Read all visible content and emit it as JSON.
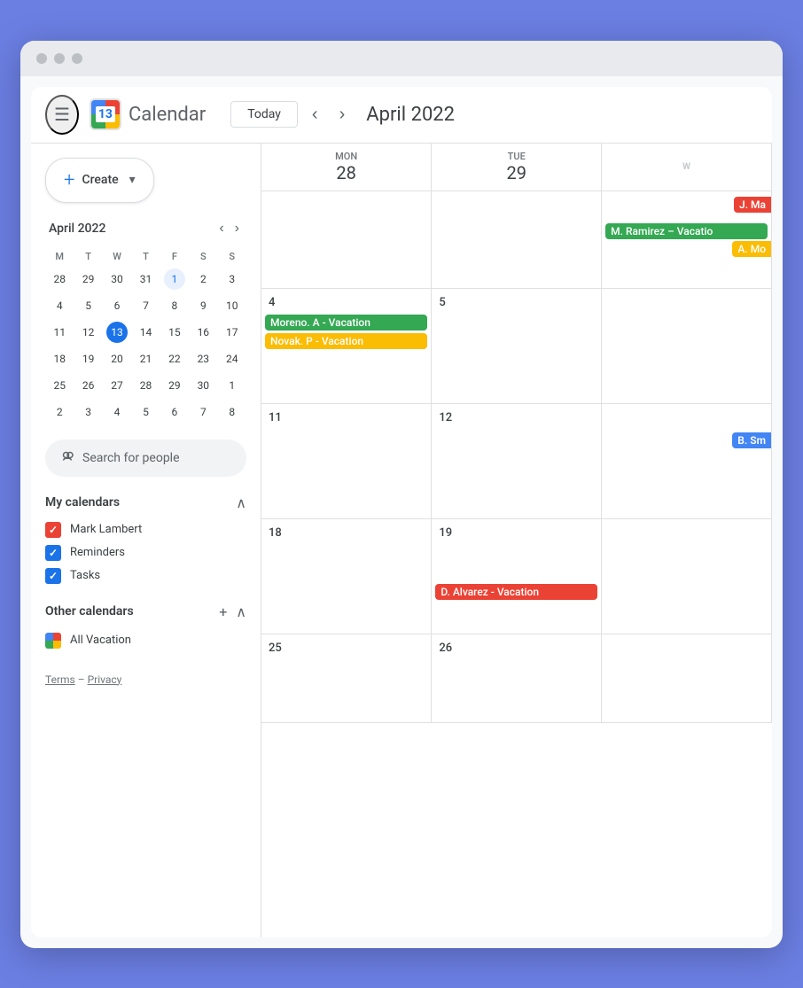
{
  "browser": {
    "dots": [
      "dot1",
      "dot2",
      "dot3"
    ]
  },
  "header": {
    "menu_icon": "☰",
    "app_name": "Calendar",
    "today_btn": "Today",
    "prev_icon": "‹",
    "next_icon": "›",
    "current_month": "April 2022"
  },
  "create_button": {
    "plus": "+",
    "label": "Create",
    "chevron": "▾"
  },
  "mini_calendar": {
    "title": "April 2022",
    "prev": "‹",
    "next": "›",
    "weekdays": [
      "M",
      "T",
      "W",
      "T",
      "F",
      "S",
      "S"
    ],
    "weeks": [
      [
        {
          "d": "28",
          "other": true
        },
        {
          "d": "29",
          "other": true
        },
        {
          "d": "30",
          "other": true
        },
        {
          "d": "31",
          "other": true
        },
        {
          "d": "1",
          "first": true
        },
        {
          "d": "2"
        },
        {
          "d": "3"
        }
      ],
      [
        {
          "d": "4"
        },
        {
          "d": "5"
        },
        {
          "d": "6"
        },
        {
          "d": "7"
        },
        {
          "d": "8"
        },
        {
          "d": "9"
        },
        {
          "d": "10"
        }
      ],
      [
        {
          "d": "11"
        },
        {
          "d": "12"
        },
        {
          "d": "13",
          "today": true
        },
        {
          "d": "14"
        },
        {
          "d": "15"
        },
        {
          "d": "16"
        },
        {
          "d": "17"
        }
      ],
      [
        {
          "d": "18"
        },
        {
          "d": "19"
        },
        {
          "d": "20"
        },
        {
          "d": "21"
        },
        {
          "d": "22"
        },
        {
          "d": "23"
        },
        {
          "d": "24"
        }
      ],
      [
        {
          "d": "25"
        },
        {
          "d": "26"
        },
        {
          "d": "27"
        },
        {
          "d": "28"
        },
        {
          "d": "29"
        },
        {
          "d": "30"
        },
        {
          "d": "1",
          "other": true
        }
      ],
      [
        {
          "d": "2",
          "other": true
        },
        {
          "d": "3",
          "other": true
        },
        {
          "d": "4",
          "other": true
        },
        {
          "d": "5",
          "other": true
        },
        {
          "d": "6",
          "other": true
        },
        {
          "d": "7",
          "other": true
        },
        {
          "d": "8",
          "other": true
        }
      ]
    ]
  },
  "search_people": {
    "placeholder": "Search for people"
  },
  "my_calendars": {
    "title": "My calendars",
    "collapse_icon": "∧",
    "items": [
      {
        "label": "Mark Lambert",
        "color": "red",
        "checked": true
      },
      {
        "label": "Reminders",
        "color": "blue",
        "checked": true
      },
      {
        "label": "Tasks",
        "color": "blue",
        "checked": true
      }
    ]
  },
  "other_calendars": {
    "title": "Other calendars",
    "add_icon": "+",
    "collapse_icon": "∧",
    "items": [
      {
        "label": "All Vacation",
        "multicolor": true,
        "checked": true
      }
    ]
  },
  "footer": {
    "terms": "Terms",
    "dash": "–",
    "privacy": "Privacy"
  },
  "calendar_grid": {
    "col_headers": [
      {
        "day_name": "MON",
        "day_num": "28"
      },
      {
        "day_name": "TUE",
        "day_num": "29"
      },
      {
        "day_name": "W",
        "day_num": ""
      }
    ],
    "weeks": [
      {
        "days": [
          {
            "num": "",
            "events": []
          },
          {
            "num": "",
            "events": []
          },
          {
            "num": "",
            "partial_event": {
              "label": "J. Ma",
              "color": "red"
            },
            "events": [
              {
                "label": "M. Ramirez –  Vacatio",
                "color": "green"
              },
              {
                "label": "A. Mo",
                "color": "orange",
                "partial": true
              }
            ]
          }
        ]
      },
      {
        "days": [
          {
            "num": "4",
            "events": [
              {
                "label": "Moreno. A - Vacation",
                "color": "green"
              },
              {
                "label": "Novak. P - Vacation",
                "color": "orange"
              }
            ]
          },
          {
            "num": "5",
            "events": []
          },
          {
            "num": "",
            "events": []
          }
        ]
      },
      {
        "days": [
          {
            "num": "11",
            "events": []
          },
          {
            "num": "12",
            "events": []
          },
          {
            "num": "",
            "partial_event": {
              "label": "B. Sm",
              "color": "blue"
            },
            "events": []
          }
        ]
      },
      {
        "days": [
          {
            "num": "18",
            "events": []
          },
          {
            "num": "19",
            "events": [
              {
                "label": "D. Alvarez -  Vacation",
                "color": "red"
              }
            ]
          },
          {
            "num": "",
            "events": []
          }
        ]
      },
      {
        "days": [
          {
            "num": "25",
            "events": []
          },
          {
            "num": "26",
            "events": []
          },
          {
            "num": "",
            "events": []
          }
        ]
      }
    ]
  }
}
